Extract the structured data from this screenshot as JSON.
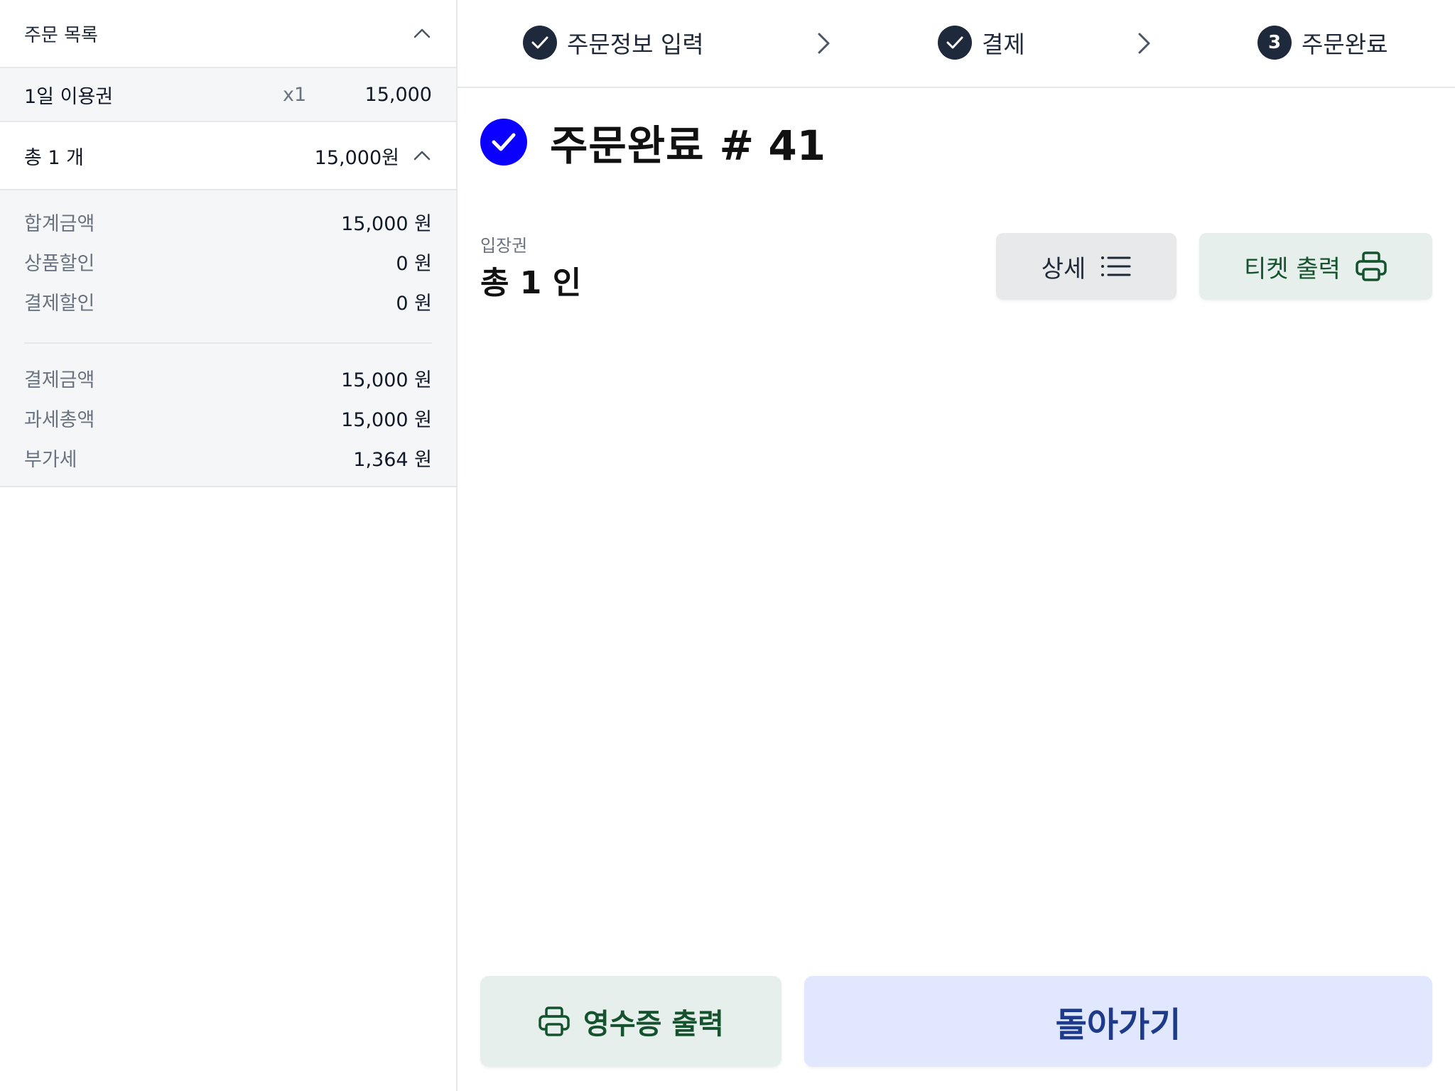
{
  "order_list": {
    "title": "주문 목록",
    "items": [
      {
        "name": "1일 이용권",
        "qty": "x1",
        "price": "15,000"
      }
    ],
    "total_label": "총 1 개",
    "total_value": "15,000원",
    "summary": [
      {
        "label": "합계금액",
        "value": "15,000 원"
      },
      {
        "label": "상품할인",
        "value": "0 원"
      },
      {
        "label": "결제할인",
        "value": "0 원"
      }
    ],
    "payment": [
      {
        "label": "결제금액",
        "value": "15,000 원"
      },
      {
        "label": "과세총액",
        "value": "15,000 원"
      },
      {
        "label": "부가세",
        "value": "1,364 원"
      }
    ]
  },
  "stepper": {
    "steps": [
      {
        "label": "주문정보 입력",
        "state": "done"
      },
      {
        "label": "결제",
        "state": "done"
      },
      {
        "label": "주문완료",
        "state": "current",
        "number": "3"
      }
    ]
  },
  "main": {
    "title": "주문완료",
    "order_number": "# 41",
    "ticket_label": "입장권",
    "ticket_total": "총 1 인",
    "detail_button": "상세",
    "print_ticket_button": "티켓 출력",
    "print_receipt_button": "영수증 출력",
    "back_button": "돌아가기"
  },
  "colors": {
    "accent_blue": "#0b00ff",
    "step_badge": "#1e293b",
    "green_text": "#14532d",
    "green_bg": "#e6efec",
    "back_bg": "#e0e7ff",
    "back_text": "#1e3a8a"
  }
}
